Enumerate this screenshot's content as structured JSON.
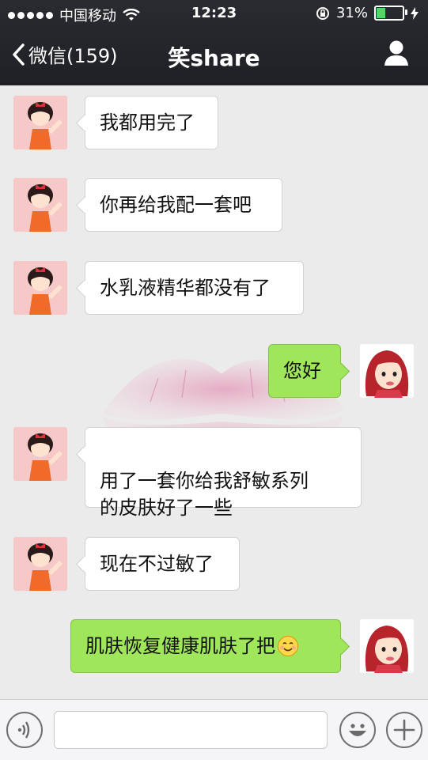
{
  "status_bar": {
    "carrier": "中国移动",
    "time": "12:23",
    "battery_percent": "31%",
    "battery_level": 0.31,
    "signal_dots": 5
  },
  "nav": {
    "back_label": "微信(159)",
    "title": "笑share"
  },
  "messages": [
    {
      "side": "left",
      "text": "我都用完了"
    },
    {
      "side": "left",
      "text": "你再给我配一套吧"
    },
    {
      "side": "left",
      "text": "水乳液精华都没有了"
    },
    {
      "side": "right",
      "text": "您好"
    },
    {
      "side": "left",
      "text": "用了一套你给我舒敏系列\n的皮肤好了一些"
    },
    {
      "side": "left",
      "text": "现在不过敏了"
    },
    {
      "side": "right",
      "text": "肌肤恢复健康肌肤了把",
      "emoji": "smile-emoji"
    }
  ],
  "colors": {
    "sent_bubble": "#9fe65a",
    "received_bubble": "#ffffff",
    "nav_background": "#222328",
    "chat_background": "#ebebeb"
  },
  "input_bar": {
    "text_value": ""
  }
}
